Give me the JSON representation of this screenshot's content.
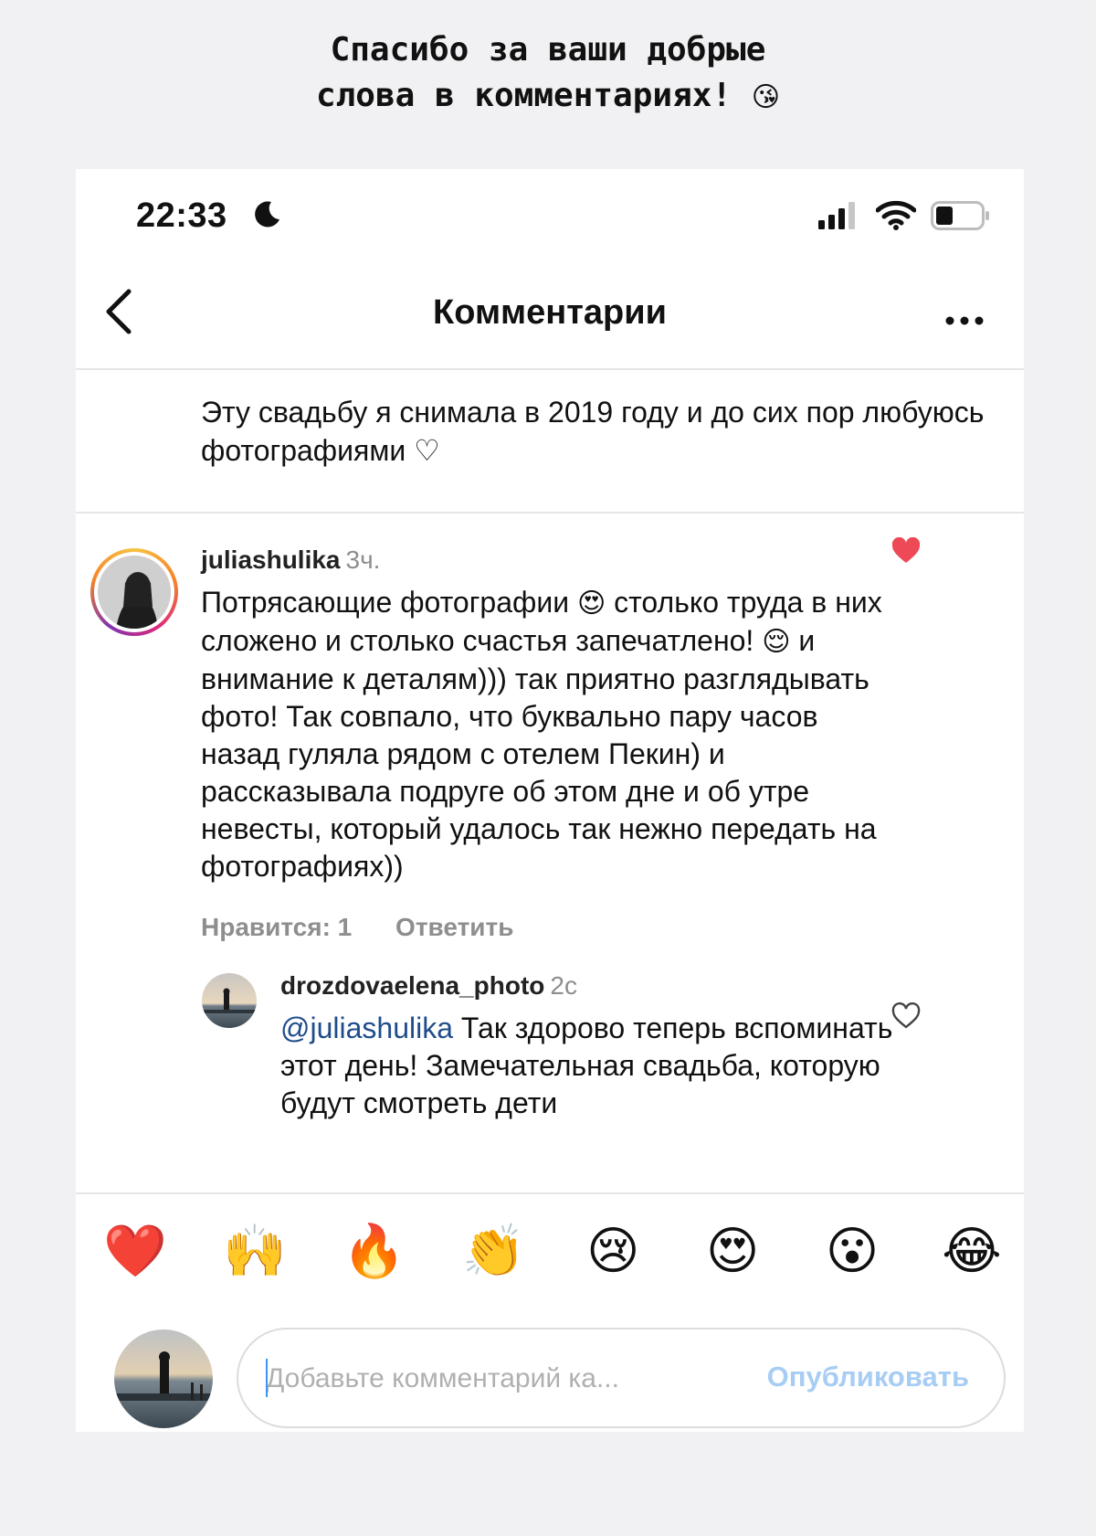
{
  "story": {
    "caption_line1": "Спасибо за ваши добрые",
    "caption_line2": "слова в комментариях!",
    "caption_emoji": "😘"
  },
  "status_bar": {
    "time": "22:33"
  },
  "header": {
    "title": "Комментарии"
  },
  "post_caption": {
    "text": "Эту свадьбу я снимала в 2019 году и до сих пор любуюсь фотографиями ♡"
  },
  "comments": [
    {
      "username": "juliashulika",
      "time": "3ч.",
      "body_part1": "Потрясающие фотографии ",
      "emoji1": "😍",
      "body_part2": " столько труда в них сложено и столько счастья запечатлено! ",
      "emoji2": "😌",
      "body_part3": " и внимание к деталям))) так приятно разглядывать фото! Так совпало, что буквально пару часов назад гуляла рядом с отелем Пекин) и рассказывала подруге об этом дне и об утре невесты, который удалось так нежно передать на фотографиях))",
      "likes_label": "Нравится: 1",
      "reply_label": "Ответить",
      "liked": true
    }
  ],
  "replies": [
    {
      "username": "drozdovaelena_photo",
      "time": "2с",
      "mention": "@juliashulika",
      "body": " Так здорово теперь вспоминать этот день! Замечательная свадьба, которую будут смотреть дети",
      "liked": false
    }
  ],
  "reactions": [
    "❤️",
    "🙌",
    "🔥",
    "👏",
    "😢",
    "😍",
    "😮",
    "😂"
  ],
  "composer": {
    "placeholder": "Добавьте комментарий ка...",
    "publish_label": "Опубликовать"
  },
  "colors": {
    "like_red": "#ed4956",
    "link_blue": "#1f4d8a",
    "publish_disabled": "#a8cdf4"
  }
}
